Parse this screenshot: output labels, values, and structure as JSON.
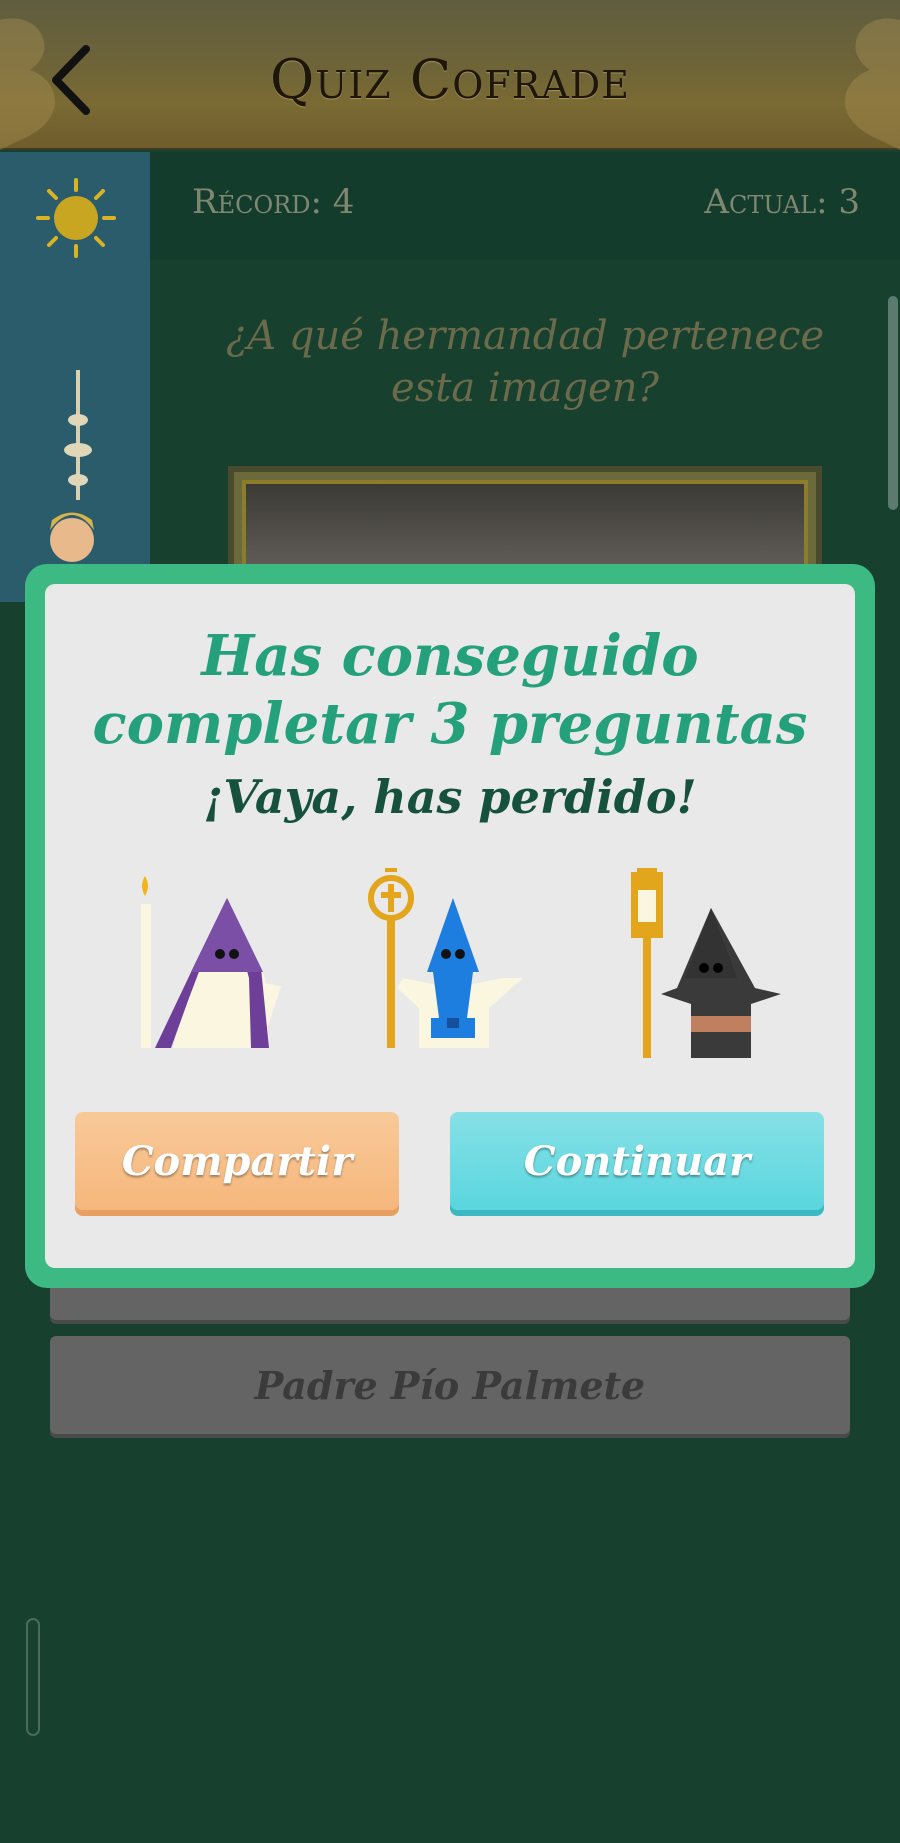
{
  "header": {
    "title": "Quiz Cofrade",
    "back_icon": "chevron-left-icon"
  },
  "scores": {
    "record": "Récord: 4",
    "actual": "Actual: 3"
  },
  "question": {
    "text": "¿A qué hermandad pertenece esta imagen?"
  },
  "answers": [
    {
      "label": ""
    },
    {
      "label": "Padre Pío Palmete"
    }
  ],
  "modal": {
    "title": "Has conseguido completar 3 preguntas",
    "subtitle": "¡Vaya, has perdido!",
    "share_label": "Compartir",
    "continue_label": "Continuar",
    "colors": {
      "frame": "#3dba84",
      "title": "#24a07a",
      "subtitle": "#15513d",
      "share": "#f6b77c",
      "continue": "#5ad6de"
    },
    "figures": [
      {
        "icon": "nazareno-purple-candle-icon",
        "hood_color": "#7b4fa6"
      },
      {
        "icon": "nazareno-blue-cross-icon",
        "hood_color": "#1e7ee0"
      },
      {
        "icon": "nazareno-black-lantern-icon",
        "hood_color": "#3a3a3a"
      }
    ]
  }
}
